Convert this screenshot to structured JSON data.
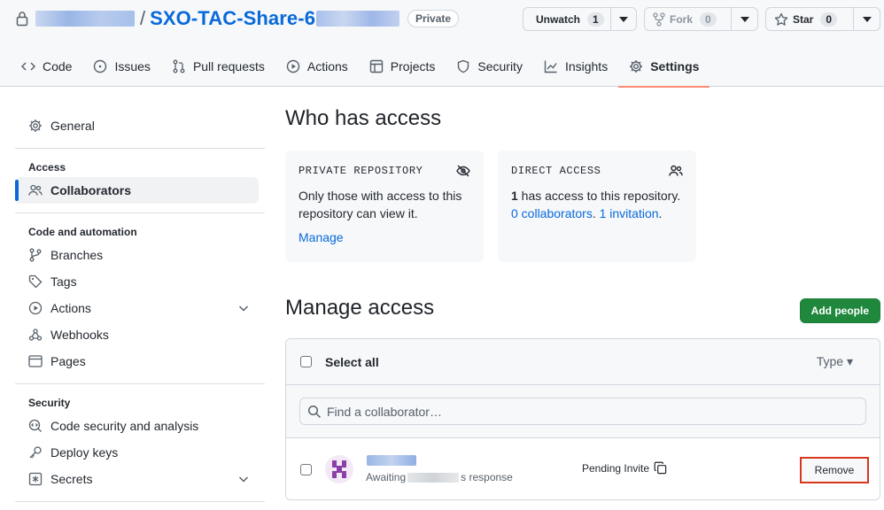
{
  "repo": {
    "name_prefix": "SXO-TAC-Share-6",
    "slash": "/",
    "visibility_badge": "Private"
  },
  "actions": {
    "watch_label": "Unwatch",
    "watch_count": "1",
    "fork_label": "Fork",
    "fork_count": "0",
    "star_label": "Star",
    "star_count": "0"
  },
  "tabs": [
    {
      "label": "Code",
      "icon": "code-icon"
    },
    {
      "label": "Issues",
      "icon": "issue-icon"
    },
    {
      "label": "Pull requests",
      "icon": "pull-request-icon"
    },
    {
      "label": "Actions",
      "icon": "play-icon"
    },
    {
      "label": "Projects",
      "icon": "table-icon"
    },
    {
      "label": "Security",
      "icon": "shield-icon"
    },
    {
      "label": "Insights",
      "icon": "graph-icon"
    },
    {
      "label": "Settings",
      "icon": "gear-icon",
      "selected": true
    }
  ],
  "sidebar": {
    "general": "General",
    "access_heading": "Access",
    "collaborators": "Collaborators",
    "automation_heading": "Code and automation",
    "branches": "Branches",
    "tags": "Tags",
    "actions": "Actions",
    "webhooks": "Webhooks",
    "pages": "Pages",
    "security_heading": "Security",
    "code_security": "Code security and analysis",
    "deploy_keys": "Deploy keys",
    "secrets": "Secrets"
  },
  "main": {
    "who_title": "Who has access",
    "private_card": {
      "label": "PRIVATE REPOSITORY",
      "text": "Only those with access to this repository can view it.",
      "link": "Manage"
    },
    "direct_card": {
      "label": "DIRECT ACCESS",
      "count": "1",
      "text_a": " has access to this repository. ",
      "collab_link": "0 collaborators",
      "sep": ". ",
      "invite_link": "1 invitation",
      "end": "."
    },
    "manage_title": "Manage access",
    "add_people": "Add people",
    "select_all": "Select all",
    "type_filter": "Type ▾",
    "search_placeholder": "Find a collaborator…",
    "member": {
      "awaiting_prefix": "Awaiting",
      "awaiting_suffix": "s response",
      "status": "Pending Invite",
      "remove": "Remove"
    }
  },
  "colors": {
    "accent": "#0969da",
    "primary_button": "#1f883d",
    "selected_tab_underline": "#fd8c73",
    "highlight_box": "#d9361e"
  }
}
